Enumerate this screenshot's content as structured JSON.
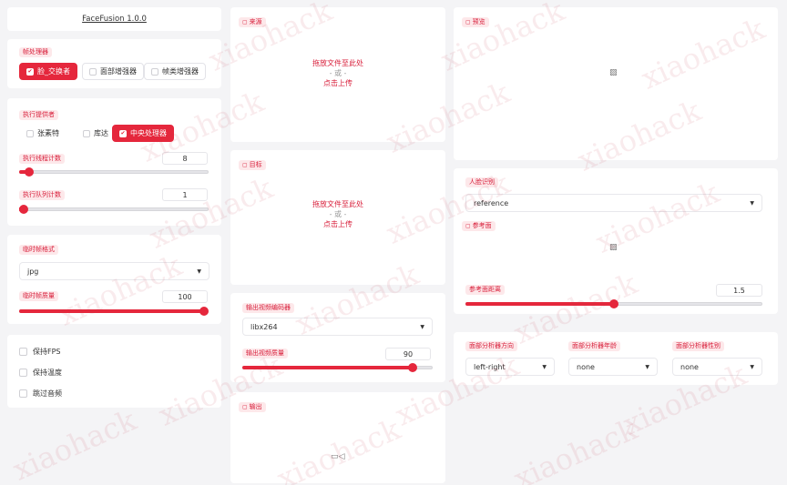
{
  "app": {
    "title": "FaceFusion 1.0.0"
  },
  "frame_processors": {
    "label": "帧处理器",
    "options": [
      {
        "label": "脸_交换者",
        "checked": true
      },
      {
        "label": "面部增强器",
        "checked": false
      },
      {
        "label": "帧类增强器",
        "checked": false
      }
    ]
  },
  "execution": {
    "providers_label": "执行提供者",
    "providers": [
      {
        "label": "张素特",
        "checked": false
      },
      {
        "label": "库达",
        "checked": false
      },
      {
        "label": "中央处理器",
        "checked": true
      }
    ],
    "thread_count_label": "执行线程计数",
    "thread_count": "8",
    "thread_count_fraction": 0.05,
    "queue_count_label": "执行队列计数",
    "queue_count": "1",
    "queue_count_fraction": 0.0
  },
  "temp_frame": {
    "format_label": "临时帧格式",
    "format": "jpg",
    "quality_label": "临时帧质量",
    "quality": "100",
    "quality_fraction": 1.0
  },
  "settings": [
    {
      "label": "保持FPS",
      "checked": false
    },
    {
      "label": "保持温度",
      "checked": false
    },
    {
      "label": "跳过音频",
      "checked": false
    }
  ],
  "source": {
    "label": "来源",
    "drop_text": "拖放文件至此处",
    "or_text": "- 或 -",
    "upload_text": "点击上传"
  },
  "target": {
    "label": "目标",
    "drop_text": "拖放文件至此处",
    "or_text": "- 或 -",
    "upload_text": "点击上传"
  },
  "output_video": {
    "encoder_label": "输出视频编码器",
    "encoder": "libx264",
    "quality_label": "输出视频质量",
    "quality": "90",
    "quality_fraction": 0.9
  },
  "output": {
    "label": "输出"
  },
  "preview": {
    "label": "预览"
  },
  "face_recognition": {
    "label": "人脸识别",
    "value": "reference"
  },
  "reference_face": {
    "label": "参考面"
  },
  "reference_distance": {
    "label": "参考面距离",
    "value": "1.5",
    "fraction": 0.5
  },
  "face_analyser": {
    "direction_label": "面部分析器方向",
    "direction": "left-right",
    "age_label": "面部分析器年龄",
    "age": "none",
    "gender_label": "面部分析器性别",
    "gender": "none"
  },
  "watermark": {
    "text": "xiaohack"
  },
  "colors": {
    "accent": "#e5273c",
    "tag_bg": "#fde8ea",
    "tag_text": "#d81e3a"
  }
}
